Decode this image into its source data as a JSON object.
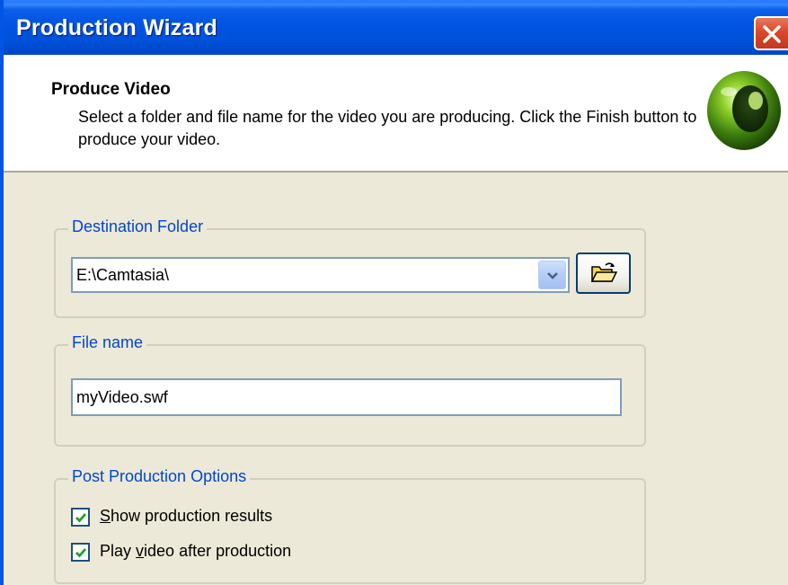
{
  "window": {
    "title": "Production Wizard"
  },
  "header": {
    "title": "Produce Video",
    "description": "Select a folder and file name for the video you are producing.  Click the Finish button to produce your video."
  },
  "destination": {
    "group_label": "Destination Folder",
    "folder_value": "E:\\Camtasia\\"
  },
  "filename": {
    "group_label": "File name",
    "value": "myVideo.swf"
  },
  "post_options": {
    "group_label": "Post Production Options",
    "show_results": {
      "label_pre": "",
      "mnemonic": "S",
      "label_post": "how production results",
      "checked": true
    },
    "play_video": {
      "label_pre": "Play ",
      "mnemonic": "v",
      "label_post": "ideo after production",
      "checked": true
    }
  },
  "icons": {
    "close": "close-icon",
    "dropdown": "chevron-down-icon",
    "browse": "open-folder-icon",
    "logo": "green-orb-logo"
  },
  "colors": {
    "titlebar": "#0054e3",
    "group_label": "#0046d5",
    "background": "#ece9d8"
  }
}
